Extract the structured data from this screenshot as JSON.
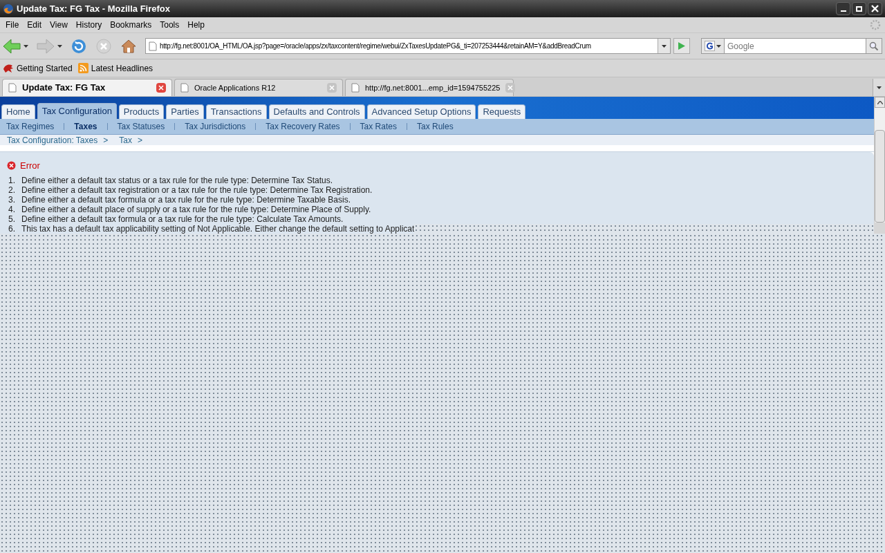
{
  "window": {
    "title": "Update Tax: FG Tax - Mozilla Firefox"
  },
  "menu": [
    "File",
    "Edit",
    "View",
    "History",
    "Bookmarks",
    "Tools",
    "Help"
  ],
  "navigation": {
    "url": "http://fg.net:8001/OA_HTML/OA.jsp?page=/oracle/apps/zx/taxcontent/regime/webui/ZxTaxesUpdatePG&_ti=207253444&retainAM=Y&addBreadCrum",
    "search_placeholder": "Google"
  },
  "bookmarks": [
    "Getting Started",
    "Latest Headlines"
  ],
  "browser_tabs": [
    {
      "label": "Update Tax: FG Tax",
      "selected": true
    },
    {
      "label": "Oracle Applications R12",
      "selected": false
    },
    {
      "label": "http://fg.net:8001...emp_id=1594755225",
      "selected": false
    }
  ],
  "app_tabs": [
    {
      "label": "Home",
      "selected": false
    },
    {
      "label": "Tax Configuration",
      "selected": true
    },
    {
      "label": "Products",
      "selected": false
    },
    {
      "label": "Parties",
      "selected": false
    },
    {
      "label": "Transactions",
      "selected": false
    },
    {
      "label": "Defaults and Controls",
      "selected": false
    },
    {
      "label": "Advanced Setup Options",
      "selected": false
    },
    {
      "label": "Requests",
      "selected": false
    }
  ],
  "sub_tabs": [
    {
      "label": "Tax Regimes",
      "selected": false
    },
    {
      "label": "Taxes",
      "selected": true
    },
    {
      "label": "Tax Statuses",
      "selected": false
    },
    {
      "label": "Tax Jurisdictions",
      "selected": false
    },
    {
      "label": "Tax Recovery Rates",
      "selected": false
    },
    {
      "label": "Tax Rates",
      "selected": false
    },
    {
      "label": "Tax Rules",
      "selected": false
    }
  ],
  "breadcrumbs": [
    {
      "label": "Tax Configuration: Taxes",
      "separator": ">"
    },
    {
      "label": "Tax",
      "separator": ">"
    }
  ],
  "error": {
    "title": "Error",
    "messages": [
      {
        "number": "1.",
        "text": "Define either a default tax status or a tax rule for the rule type: Determine Tax Status."
      },
      {
        "number": "2.",
        "text": "Define either a default tax registration or a tax rule for the rule type: Determine Tax Registration."
      },
      {
        "number": "3.",
        "text": "Define either a default tax formula or a tax rule for the rule type: Determine Taxable Basis."
      },
      {
        "number": "4.",
        "text": "Define either a default place of supply or a tax rule for the rule type: Determine Place of Supply."
      },
      {
        "number": "5.",
        "text": "Define either a default tax formula or a tax rule for the rule type: Calculate Tax Amounts."
      },
      {
        "number": "6.",
        "text": "This tax has a default tax applicability setting of Not Applicable. Either change the default setting to Applicat"
      }
    ]
  }
}
